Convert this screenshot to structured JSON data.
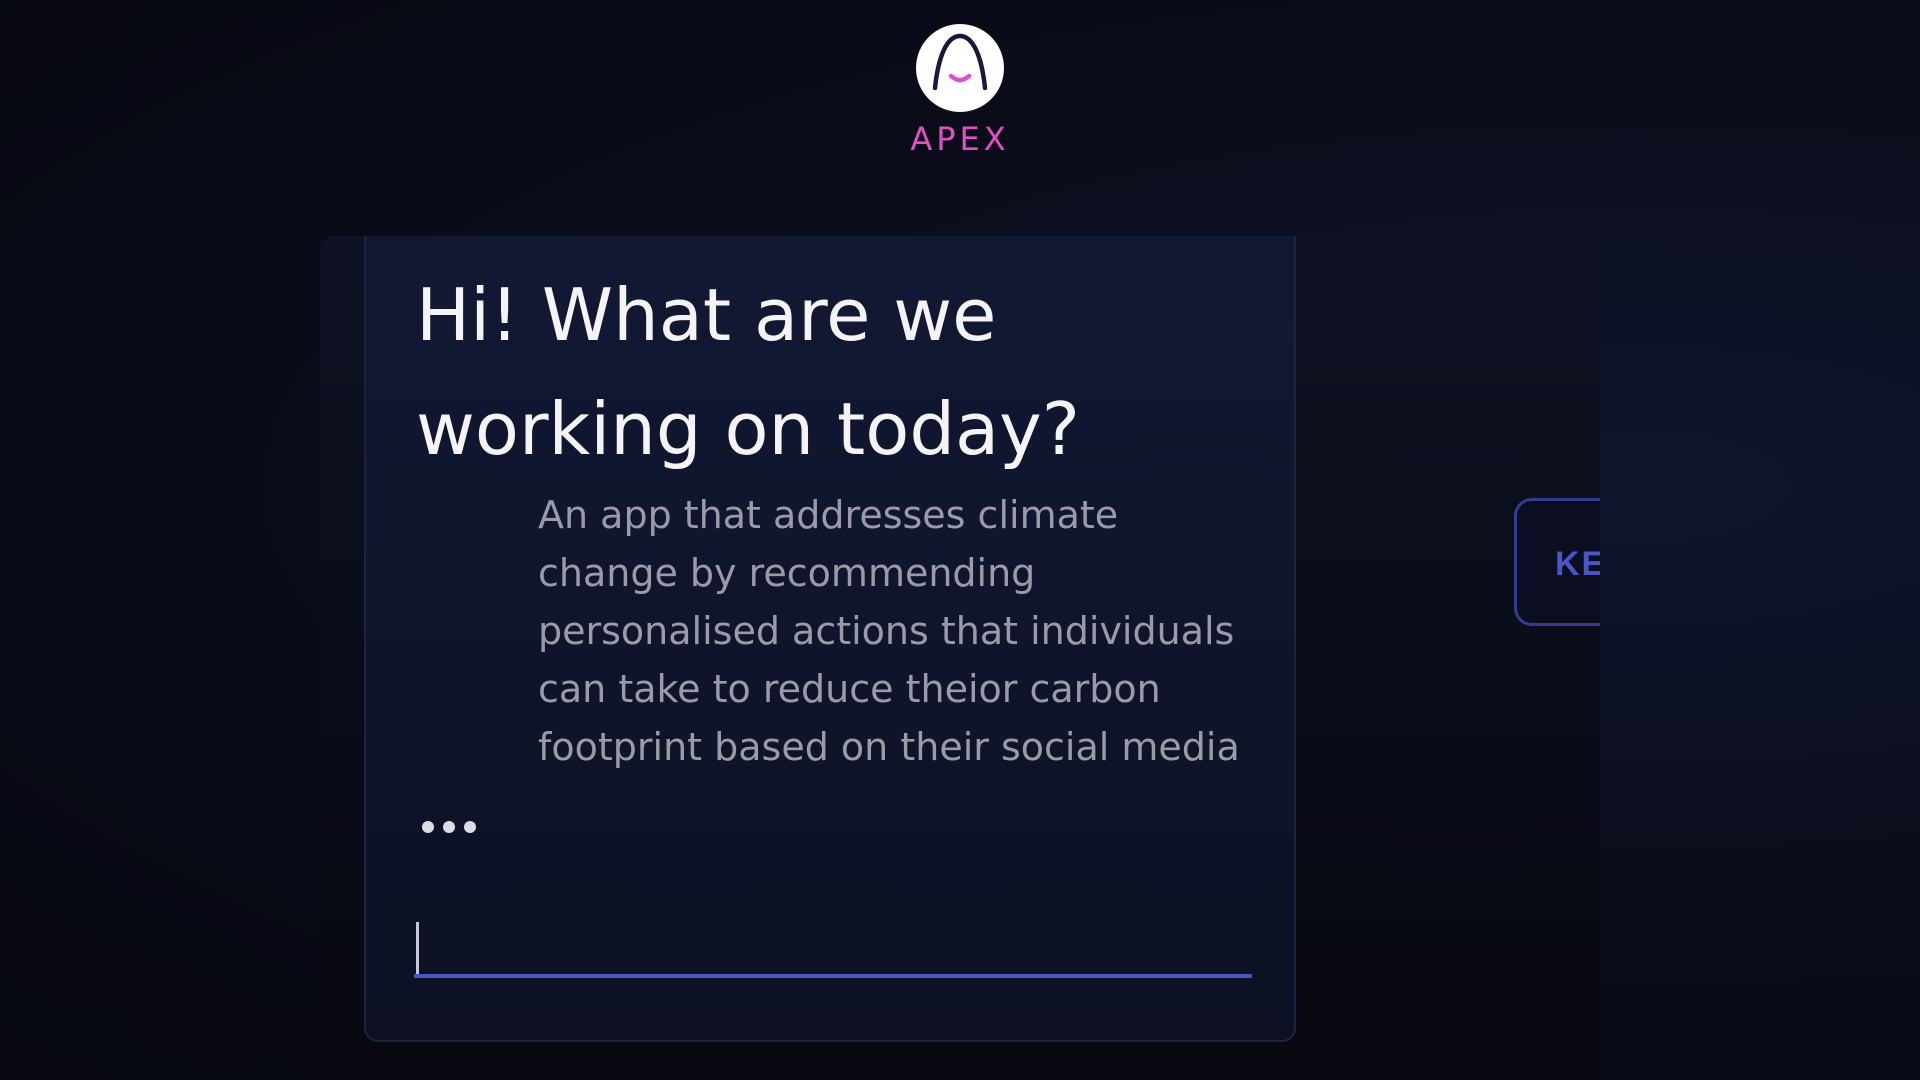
{
  "app": {
    "brand_name": "APEX",
    "logo_icon": "apex-arch-smile-logo",
    "brand_color": "#e24fc2"
  },
  "chat": {
    "greeting": "Hi! What are we working on today?",
    "user_message": "An app that addresses climate change by recommending personalised actions that individuals can take to reduce theior carbon footprint based on their social media",
    "typing_indicator_icon": "ellipsis-icon",
    "input_value": "",
    "input_underline_color": "#4a52c8"
  },
  "side_button": {
    "label_visible": "KE"
  }
}
